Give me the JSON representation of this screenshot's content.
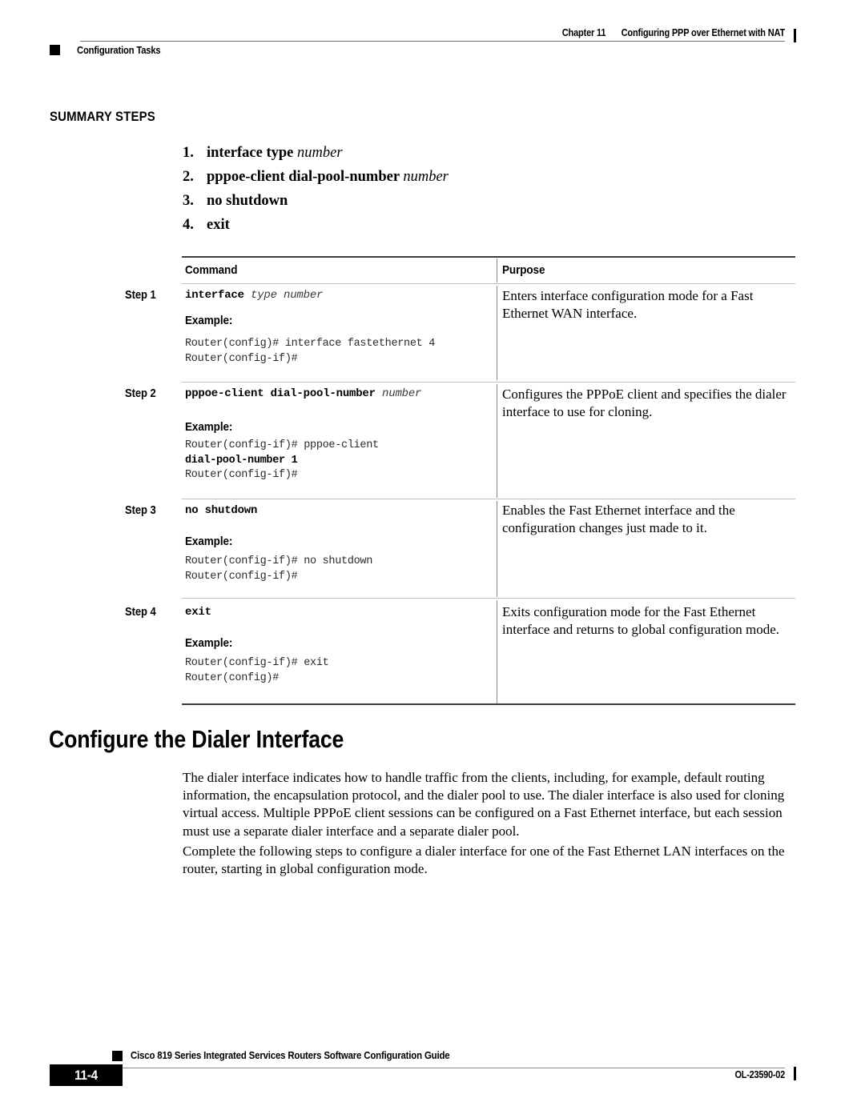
{
  "header": {
    "chapter_number": "Chapter 11",
    "chapter_title": "Configuring PPP over Ethernet with NAT",
    "section_label": "Configuration Tasks"
  },
  "summary": {
    "title": "SUMMARY STEPS",
    "items": [
      {
        "num": "1.",
        "bold": "interface type ",
        "italic": "number"
      },
      {
        "num": "2.",
        "bold": "pppoe-client dial-pool-number ",
        "italic": "number"
      },
      {
        "num": "3.",
        "bold": "no shutdown",
        "italic": ""
      },
      {
        "num": "4.",
        "bold": "exit",
        "italic": ""
      }
    ]
  },
  "table": {
    "headers": {
      "command": "Command",
      "purpose": "Purpose"
    },
    "example_label": "Example:",
    "rows": [
      {
        "step": "Step 1",
        "command_bold": "interface",
        "command_italic": " type number",
        "example_lines": "Router(config)# interface fastethernet 4\nRouter(config-if)#",
        "example_bold_line": "",
        "purpose": "Enters interface configuration mode for a Fast Ethernet WAN interface."
      },
      {
        "step": "Step 2",
        "command_bold": "pppoe-client dial-pool-number",
        "command_italic": " number",
        "example_lines": "Router(config-if)# pppoe-client",
        "example_bold_line": "dial-pool-number 1",
        "example_tail": "Router(config-if)#",
        "purpose": "Configures the PPPoE client and specifies the dialer interface to use for cloning."
      },
      {
        "step": "Step 3",
        "command_bold": "no shutdown",
        "command_italic": "",
        "example_lines": "Router(config-if)# no shutdown\nRouter(config-if)#",
        "example_bold_line": "",
        "purpose": "Enables the Fast Ethernet interface and the configuration changes just made to it."
      },
      {
        "step": "Step 4",
        "command_bold": "exit",
        "command_italic": "",
        "example_lines": "Router(config-if)# exit\nRouter(config)#",
        "example_bold_line": "",
        "purpose": "Exits configuration mode for the Fast Ethernet interface and returns to global configuration mode."
      }
    ]
  },
  "section": {
    "heading": "Configure the Dialer Interface",
    "paragraph_1": "The dialer interface indicates how to handle traffic from the clients, including, for example, default routing information, the encapsulation protocol, and the dialer pool to use. The dialer interface is also used for cloning virtual access. Multiple PPPoE client sessions can be configured on a Fast Ethernet interface, but each session must use a separate dialer interface and a separate dialer pool.",
    "paragraph_2": "Complete the following steps to configure a dialer interface for one of the Fast Ethernet LAN interfaces on the router, starting in global configuration mode."
  },
  "footer": {
    "document_title": "Cisco 819 Series Integrated Services Routers Software Configuration Guide",
    "page_number": "11-4",
    "document_id": "OL-23590-02"
  }
}
